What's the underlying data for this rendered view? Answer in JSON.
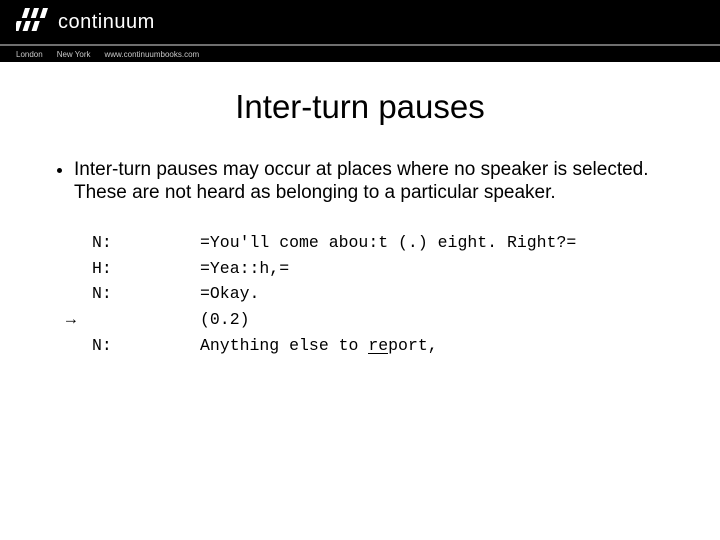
{
  "header": {
    "brand": "continuum",
    "subnav": [
      "London",
      "New York",
      "www.continuumbooks.com"
    ]
  },
  "slide": {
    "title": "Inter-turn pauses",
    "bullet": "Inter-turn pauses may occur at places where no speaker is selected. These are not heard as belonging to a particular speaker."
  },
  "transcript": [
    {
      "arrow": "",
      "speaker": "N:",
      "text": "=You'll come abou:t (.) eight. Right?="
    },
    {
      "arrow": "",
      "speaker": "H:",
      "text": "=Yea::h,="
    },
    {
      "arrow": "",
      "speaker": "N:",
      "text": "=Okay."
    },
    {
      "arrow": "→",
      "speaker": "",
      "text": "(0.2)"
    },
    {
      "arrow": "",
      "speaker": "N:",
      "text": "Anything else to report,"
    }
  ],
  "transcript_underline_segment": "re",
  "colors": {
    "header_bg": "#000000",
    "header_divider": "#6f6f6f",
    "subnav_text": "#c9c9c9",
    "page_bg": "#ffffff",
    "text": "#000000"
  }
}
